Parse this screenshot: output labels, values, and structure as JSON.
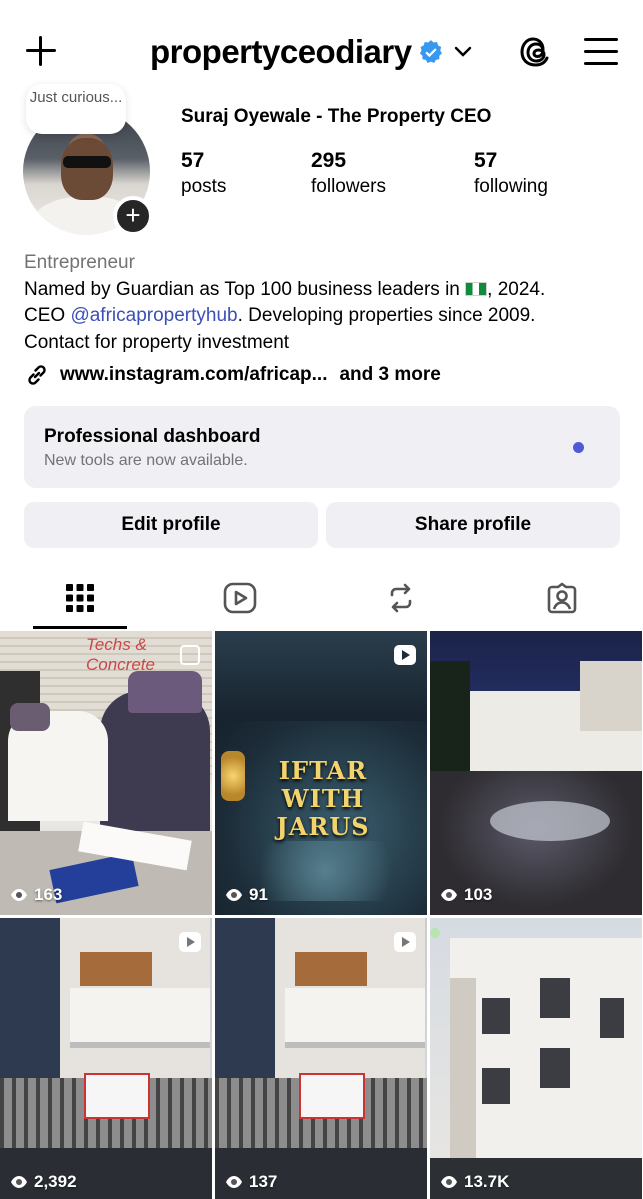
{
  "header": {
    "username": "propertyceodiary"
  },
  "profile": {
    "note": "Just curious...",
    "full_name": "Suraj Oyewale - The Property CEO",
    "stats": [
      {
        "value": "57",
        "label": "posts"
      },
      {
        "value": "295",
        "label": "followers"
      },
      {
        "value": "57",
        "label": "following"
      }
    ],
    "category": "Entrepreneur",
    "bio_line1_before": "Named by Guardian as Top 100 business leaders in ",
    "bio_line1_after": ", 2024.",
    "bio_line2_before": "CEO ",
    "bio_mention": "@africapropertyhub",
    "bio_line2_after": ". Developing properties since 2009.",
    "bio_line3": "Contact for property investment",
    "link": "www.instagram.com/africap...",
    "link_more": "and 3 more"
  },
  "dashboard": {
    "title": "Professional dashboard",
    "subtitle": "New tools are now available."
  },
  "buttons": {
    "edit": "Edit profile",
    "share": "Share profile"
  },
  "posts": [
    {
      "views": "163",
      "caption": "Techs & Concrete",
      "type": "photo"
    },
    {
      "views": "91",
      "caption": "IFTAR WITH JARUS",
      "type": "reel"
    },
    {
      "views": "103",
      "caption": "",
      "type": "photo"
    },
    {
      "views": "2,392",
      "caption": "",
      "type": "reel"
    },
    {
      "views": "137",
      "caption": "",
      "type": "reel"
    },
    {
      "views": "13.7K",
      "caption": "",
      "type": "photo"
    }
  ]
}
